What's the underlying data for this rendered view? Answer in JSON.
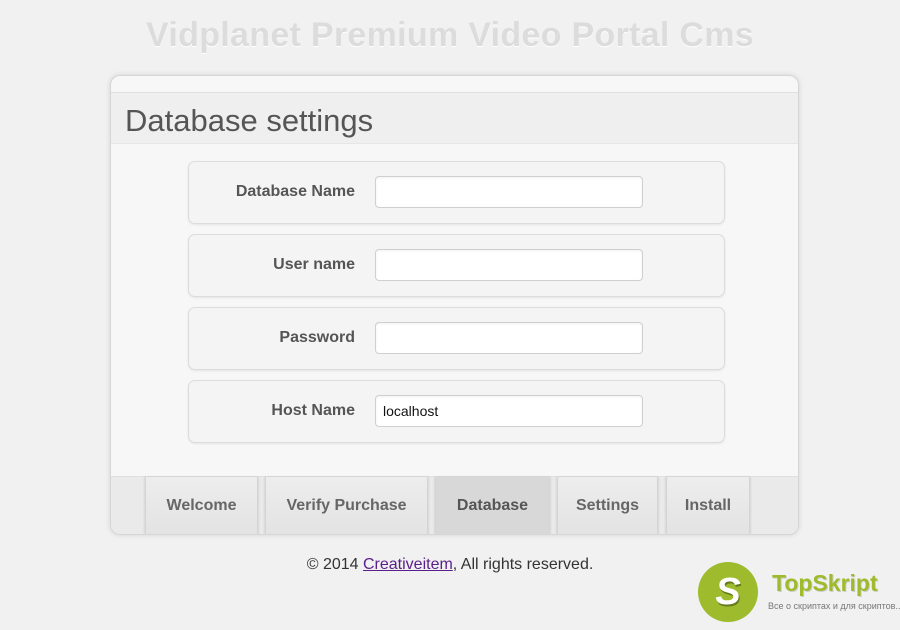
{
  "app_title": "Vidplanet Premium Video Portal Cms",
  "panel": {
    "title": "Database settings",
    "fields": [
      {
        "label": "Database Name",
        "value": ""
      },
      {
        "label": "User name",
        "value": ""
      },
      {
        "label": "Password",
        "value": ""
      },
      {
        "label": "Host Name",
        "value": "localhost"
      }
    ]
  },
  "tabs": [
    {
      "label": "Welcome",
      "active": false
    },
    {
      "label": "Verify Purchase",
      "active": false
    },
    {
      "label": "Database",
      "active": true
    },
    {
      "label": "Settings",
      "active": false
    },
    {
      "label": "Install",
      "active": false
    }
  ],
  "footer": {
    "prefix": "© 2014 ",
    "link": "Creativeitem",
    "suffix": ", All rights reserved."
  },
  "watermark": {
    "logo_letter": "S",
    "name": "TopSkript",
    "tagline": "Все о скриптах и для скриптов..."
  },
  "colors": {
    "accent": "#9dbb2c",
    "link": "#5a1f8a"
  }
}
